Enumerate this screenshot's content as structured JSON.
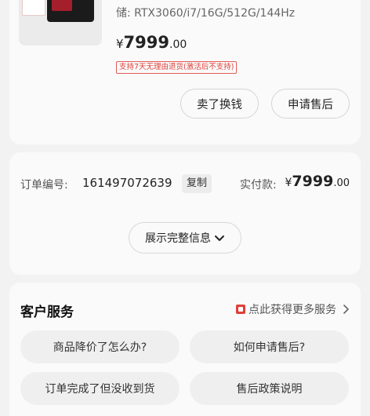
{
  "product": {
    "spec": "储: RTX3060/i7/16G/512G/144Hz",
    "price": {
      "symbol": "¥",
      "integer": "7999",
      "decimal": ".00"
    },
    "return_policy": "支持7天无理由退货(激活后不支持)",
    "buttons": {
      "sell": "卖了换钱",
      "aftersale": "申请售后"
    }
  },
  "order": {
    "number_label": "订单编号:",
    "number": "161497072639",
    "copy_label": "复制",
    "paid_label": "实付款:",
    "paid": {
      "symbol": "¥",
      "integer": "7999",
      "decimal": ".00"
    },
    "expand_label": "展示完整信息"
  },
  "service": {
    "title": "客户服务",
    "more_label": "点此获得更多服务",
    "faqs": [
      "商品降价了怎么办?",
      "如何申请售后?",
      "订单完成了但没收到货",
      "售后政策说明"
    ]
  },
  "colors": {
    "accent_red": "#e0403a",
    "background": "#f2f2f2",
    "card": "#fafafa"
  },
  "icons": {
    "expand": "chevron-down-icon",
    "service": "service-icon",
    "more": "chevron-right-icon"
  }
}
